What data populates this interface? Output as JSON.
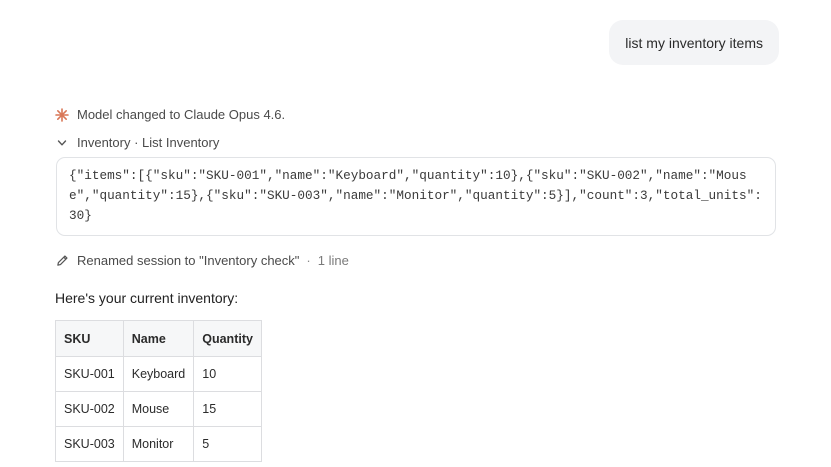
{
  "user_message": "list my inventory items",
  "model_notice": {
    "icon": "sparkle-icon",
    "color": "#d97757",
    "text": "Model changed to Claude Opus 4.6."
  },
  "tool_call": {
    "icon": "chevron-down-icon",
    "label": "Inventory · List Inventory",
    "output": "{\"items\":[{\"sku\":\"SKU-001\",\"name\":\"Keyboard\",\"quantity\":10},{\"sku\":\"SKU-002\",\"name\":\"Mouse\",\"quantity\":15},{\"sku\":\"SKU-003\",\"name\":\"Monitor\",\"quantity\":5}],\"count\":3,\"total_units\":30}"
  },
  "rename_notice": {
    "icon": "pencil-icon",
    "text": "Renamed session to \"Inventory check\"",
    "separator": "·",
    "meta": "1 line"
  },
  "assistant": {
    "intro": "Here's your current inventory:",
    "table": {
      "headers": [
        "SKU",
        "Name",
        "Quantity"
      ],
      "rows": [
        [
          "SKU-001",
          "Keyboard",
          "10"
        ],
        [
          "SKU-002",
          "Mouse",
          "15"
        ],
        [
          "SKU-003",
          "Monitor",
          "5"
        ]
      ]
    }
  }
}
